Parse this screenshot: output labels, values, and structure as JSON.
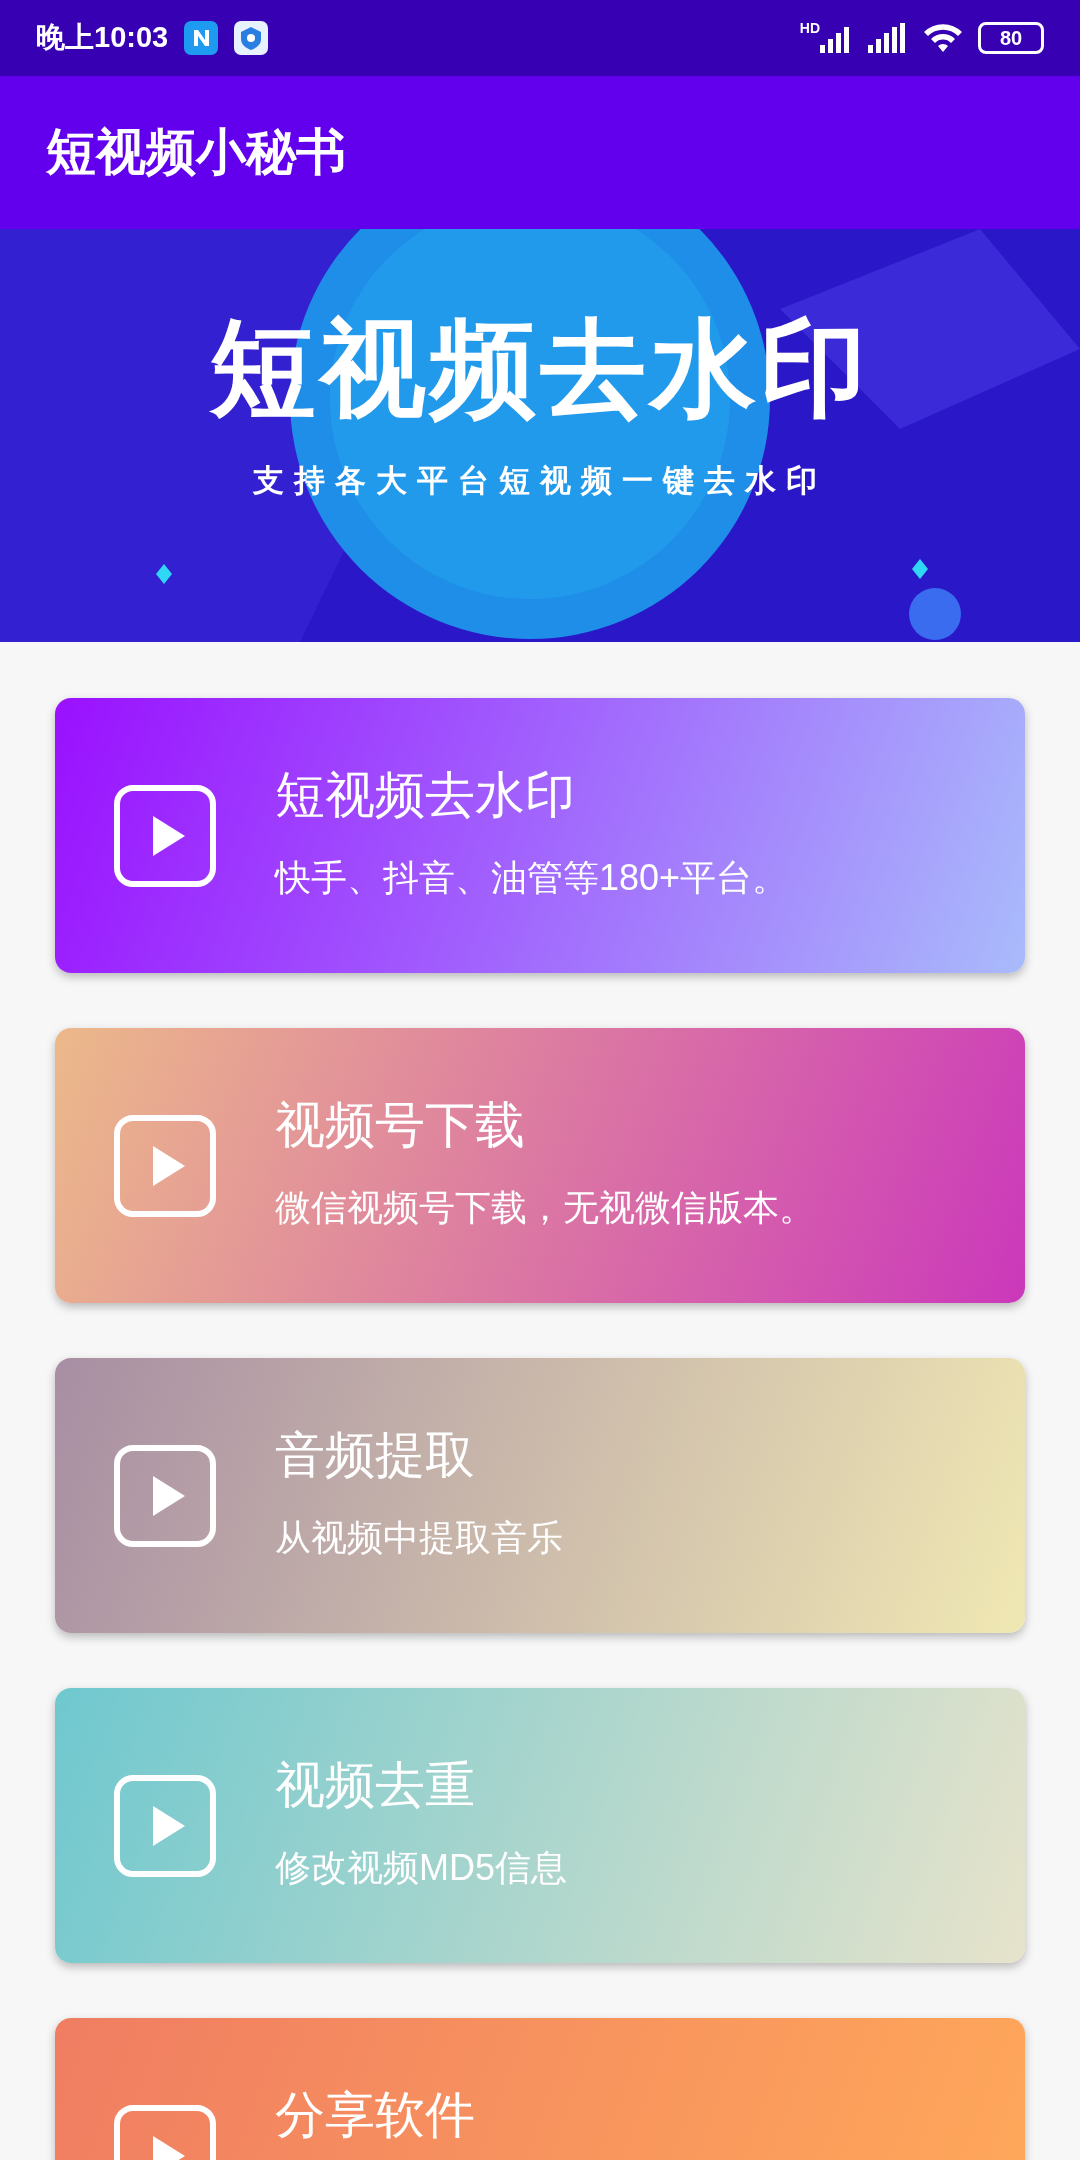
{
  "status_bar": {
    "time": "晚上10:03",
    "battery": "80",
    "network": "HD"
  },
  "app_bar": {
    "title": "短视频小秘书"
  },
  "banner": {
    "title": "短视频去水印",
    "subtitle": "支持各大平台短视频一键去水印"
  },
  "cards": [
    {
      "title": "短视频去水印",
      "subtitle": "快手、抖音、油管等180+平台。",
      "stops": [
        {
          "color": "#9a10ff"
        },
        {
          "color": "#a9bbfb"
        }
      ]
    },
    {
      "title": "视频号下载",
      "subtitle": "微信视频号下载，无视微信版本。",
      "stops": [
        {
          "color": "#ecb98a"
        },
        {
          "color": "#cb38bb"
        }
      ]
    },
    {
      "title": "音频提取",
      "subtitle": "从视频中提取音乐",
      "stops": [
        {
          "color": "#a88ea3"
        },
        {
          "color": "#f0e8b3"
        }
      ]
    },
    {
      "title": "视频去重",
      "subtitle": "修改视频MD5信息",
      "stops": [
        {
          "color": "#6fc8cf"
        },
        {
          "color": "#e7e3cb"
        }
      ]
    },
    {
      "title": "分享软件",
      "stops": [
        {
          "color": "#f07d62"
        },
        {
          "color": "#ffa95a"
        }
      ]
    }
  ]
}
